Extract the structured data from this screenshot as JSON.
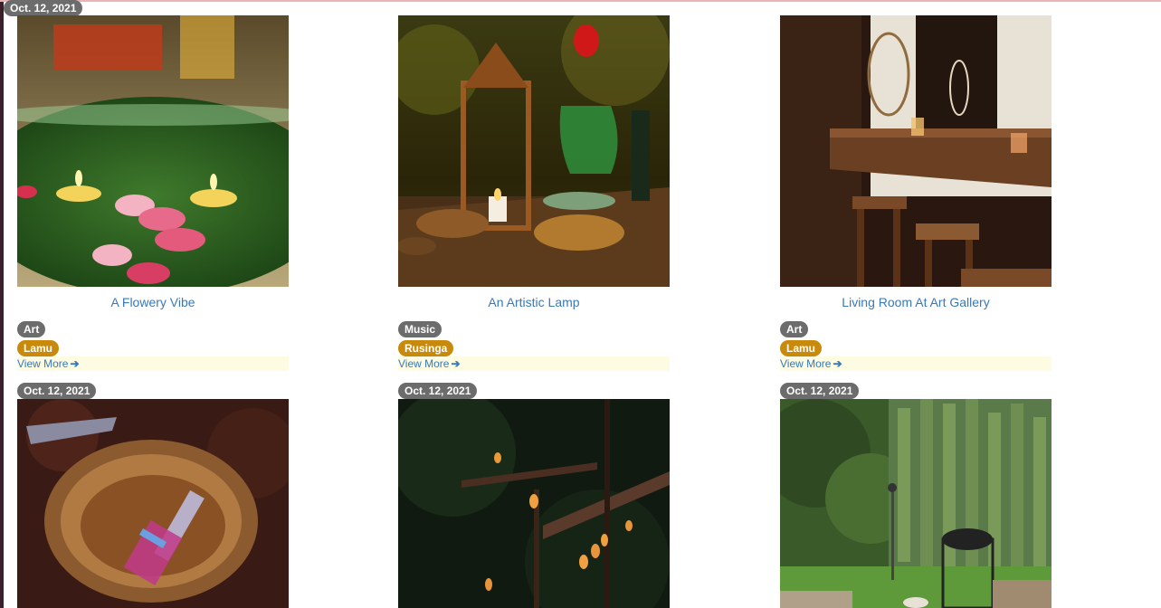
{
  "cards": [
    {
      "date": "Oct. 12, 2021",
      "title": "A Flowery Vibe",
      "category": "Art",
      "location": "Lamu",
      "view_more": "View More",
      "arrow_icon": "arrow-right-icon"
    },
    {
      "date": "Oct. 12, 2021",
      "title": "An Artistic Lamp",
      "category": "Music",
      "location": "Rusinga",
      "view_more": "View More",
      "arrow_icon": "arrow-right-icon"
    },
    {
      "date": "Oct. 12, 2021",
      "title": "Living Room At Art Gallery",
      "category": "Art",
      "location": "Lamu",
      "view_more": "View More",
      "arrow_icon": "arrow-right-icon"
    },
    {
      "date": "Oct. 12, 2021"
    },
    {
      "date": "Oct. 12, 2021"
    },
    {
      "date": "Oct. 12, 2021"
    }
  ],
  "colors": {
    "badge": "#6c6c6c",
    "location_tag": "#c98a0c",
    "link": "#3a78b8",
    "viewmore_bg": "#fdfbe1"
  }
}
